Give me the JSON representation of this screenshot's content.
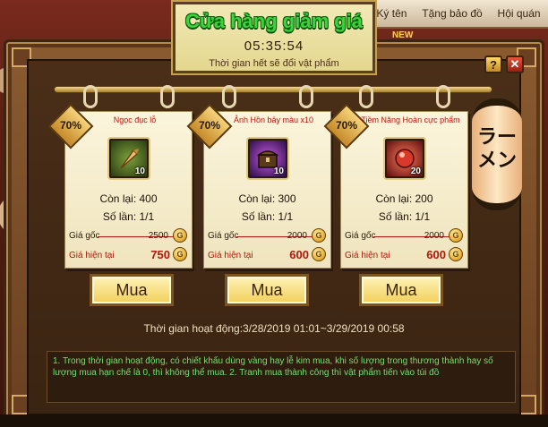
{
  "top_menu": {
    "items": [
      "Ký tên",
      "Tặng bảo đồ",
      "Hội quán"
    ]
  },
  "new_tag": "NEW",
  "header": {
    "title": "Cửa hàng giảm giá",
    "timer": "05:35:54",
    "note": "Thời gian hết sẽ đổi vật phẩm"
  },
  "window_buttons": {
    "help": "?",
    "close": "✕"
  },
  "lantern_text": "ラーメン",
  "cards": [
    {
      "discount": "70%",
      "name": "Ngọc đục lỗ",
      "icon": "drill-icon",
      "quantity": "10",
      "remaining": "Còn lại: 400",
      "limit": "Số lần: 1/1",
      "original_label": "Giá gốc",
      "original_price": "2500",
      "current_label": "Giá hiện tại",
      "current_price": "750",
      "buy_label": "Mua"
    },
    {
      "discount": "70%",
      "name": "Ảnh Hồn bảy màu x10",
      "icon": "treasure-chest-icon",
      "quantity": "10",
      "remaining": "Còn lại: 300",
      "limit": "Số lần: 1/1",
      "original_label": "Giá gốc",
      "original_price": "2000",
      "current_label": "Giá hiện tại",
      "current_price": "600",
      "buy_label": "Mua"
    },
    {
      "discount": "70%",
      "name": "Tiềm Năng Hoàn cực phẩm",
      "icon": "red-orb-icon",
      "quantity": "20",
      "remaining": "Còn lại: 200",
      "limit": "Số lần: 1/1",
      "original_label": "Giá gốc",
      "original_price": "2000",
      "current_label": "Giá hiện tại",
      "current_price": "600",
      "buy_label": "Mua"
    }
  ],
  "active_time": "Thời gian hoạt động:3/28/2019 01:01~3/29/2019 00:58",
  "info_text": "1. Trong thời gian hoạt động, có chiết khấu dùng vàng hay lễ kim mua, khi số lượng trong thương thành hay số lượng mua hạn chế là 0, thì không thể mua. 2. Tranh mua thành công thì vật phẩm tiến vào túi đồ",
  "colors": {
    "title_green": "#3bd43b",
    "price_red": "#b3160a",
    "info_green": "#6fe36f"
  }
}
